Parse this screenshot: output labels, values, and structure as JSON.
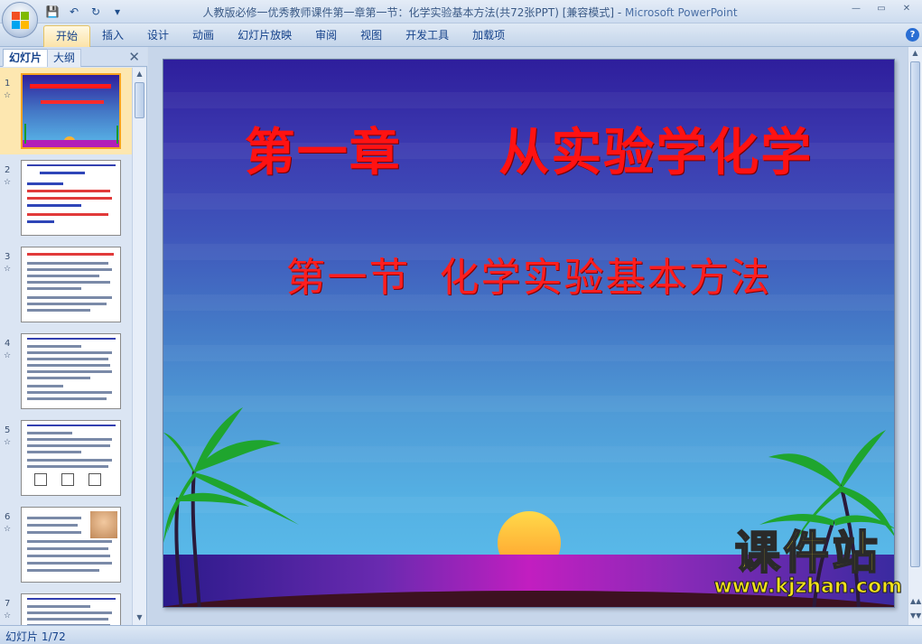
{
  "window": {
    "title": "人教版必修一优秀教师课件第一章第一节：化学实验基本方法(共72张PPT) [兼容模式] - ",
    "app_name": "Microsoft PowerPoint",
    "controls": {
      "minimize": "—",
      "maximize": "▭",
      "close": "✕"
    }
  },
  "quick_access": {
    "save": "💾",
    "undo": "↶",
    "redo": "↻",
    "more": "▾"
  },
  "ribbon": {
    "tabs": [
      {
        "label": "开始",
        "active": true
      },
      {
        "label": "插入"
      },
      {
        "label": "设计"
      },
      {
        "label": "动画"
      },
      {
        "label": "幻灯片放映"
      },
      {
        "label": "审阅"
      },
      {
        "label": "视图"
      },
      {
        "label": "开发工具"
      },
      {
        "label": "加载项"
      }
    ],
    "help": "?"
  },
  "left_pane": {
    "tab_slides": "幻灯片",
    "tab_outline": "大纲",
    "close": "✕",
    "thumbnails": [
      {
        "num": "1",
        "star": "☆",
        "selected": true
      },
      {
        "num": "2",
        "star": "☆"
      },
      {
        "num": "3",
        "star": "☆"
      },
      {
        "num": "4",
        "star": "☆"
      },
      {
        "num": "5",
        "star": "☆"
      },
      {
        "num": "6",
        "star": "☆"
      },
      {
        "num": "7",
        "star": "☆"
      }
    ]
  },
  "slide": {
    "title": "第一章     从实验学化学",
    "subtitle": "第一节  化学实验基本方法",
    "colors": {
      "title": "#ff1212",
      "sky_top": "#2e1e9c",
      "sky_bottom": "#5ab9ea",
      "sun": "#ffb230"
    }
  },
  "watermark": {
    "logo": "课件站",
    "url": "www.kjzhan.com"
  },
  "status": {
    "slide_position": "幻灯片 1/72"
  }
}
